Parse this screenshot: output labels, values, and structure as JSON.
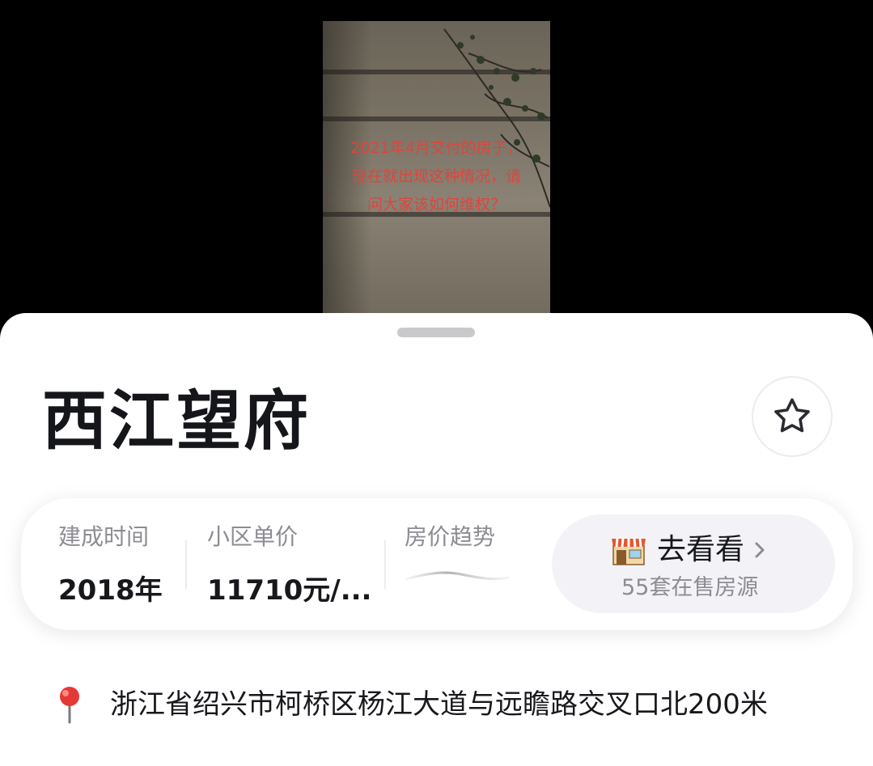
{
  "video": {
    "caption": "2021年4月交付的房子，现在就出现这种情况，请问大家该如何维权？"
  },
  "property": {
    "name": "西江望府"
  },
  "stats": {
    "build_time_label": "建成时间",
    "build_time_value": "2018年",
    "unit_price_label": "小区单价",
    "unit_price_value": "11710元/...",
    "price_trend_label": "房价趋势"
  },
  "go_button": {
    "label": "去看看",
    "sub": "55套在售房源",
    "icon": "shop-icon"
  },
  "address": {
    "text": "浙江省绍兴市柯桥区杨江大道与远瞻路交叉口北200米",
    "icon": "map-pin-icon"
  },
  "colors": {
    "caption": "#e0443c",
    "sheet_bg": "#ffffff",
    "button_bg": "#f3f3f7",
    "pin_red": "#e53935"
  }
}
